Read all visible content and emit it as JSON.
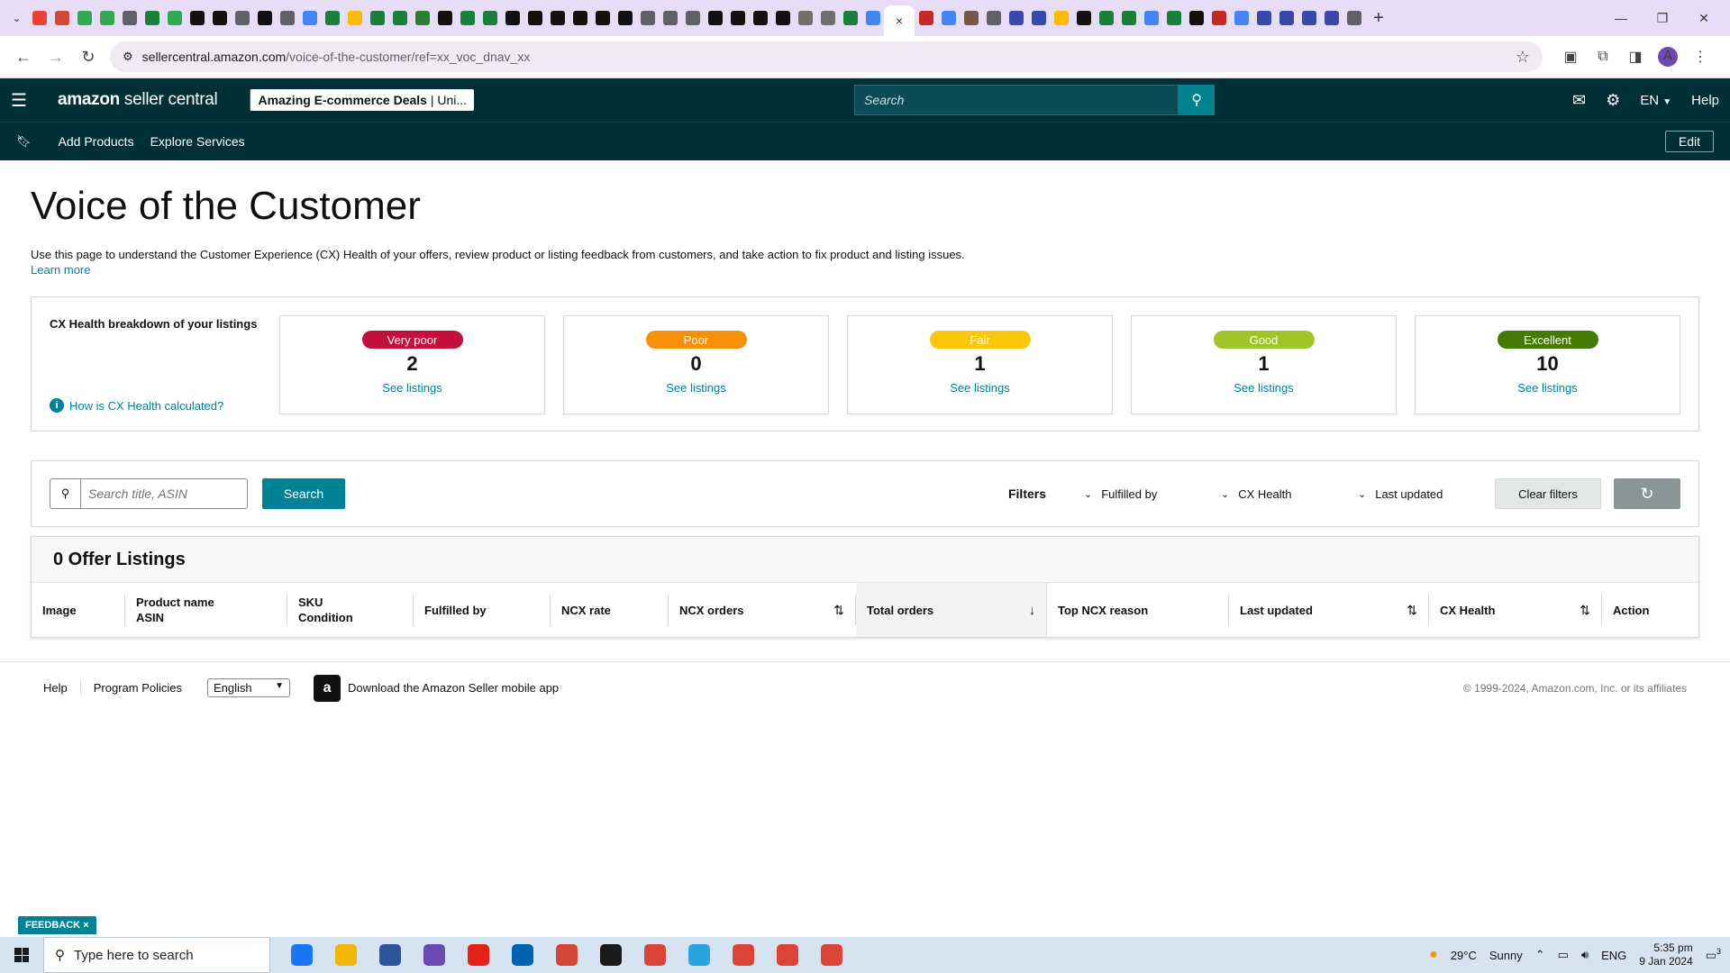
{
  "browser": {
    "tab_favicon_colors": [
      "#ea4335",
      "#d44638",
      "#34a853",
      "#34a853",
      "#5f6368",
      "#188038",
      "#34a853",
      "#111111",
      "#111111",
      "#5f6368",
      "#111111",
      "#5f6368",
      "#4285f4",
      "#188038",
      "#fbbc04",
      "#188038",
      "#188038",
      "#2e7d32",
      "#111111",
      "#188038",
      "#188038",
      "#111111",
      "#111111",
      "#111111",
      "#111111",
      "#111111",
      "#111111",
      "#5f6368",
      "#5f6368",
      "#5f6368",
      "#111111",
      "#111111",
      "#111111",
      "#111111",
      "#6f6f6f",
      "#6f6f6f",
      "#188038",
      "#4285f4"
    ],
    "tab_favicon_colors_right": [
      "#c62828",
      "#4285f4",
      "#795548",
      "#5f6368",
      "#3949ab",
      "#3949ab",
      "#fbbc04",
      "#111111",
      "#188038",
      "#188038",
      "#4285f4",
      "#188038",
      "#111111",
      "#c62828",
      "#4285f4",
      "#3949ab",
      "#3949ab",
      "#3949ab",
      "#3949ab",
      "#5f6368"
    ],
    "active_tab_close": "×",
    "new_tab": "+",
    "url_host": "sellercentral.amazon.com",
    "url_path": "/voice-of-the-customer/ref=xx_voc_dnav_xx",
    "avatar_letter": "A"
  },
  "header": {
    "logo_bold": "amazon",
    "logo_rest": " seller central",
    "store_name": "Amazing E-commerce Deals",
    "store_region": " | Uni...",
    "search_placeholder": "Search",
    "lang": "EN",
    "help": "Help"
  },
  "subnav": {
    "items": [
      "Add Products",
      "Explore Services"
    ],
    "edit": "Edit"
  },
  "page": {
    "title": "Voice of the Customer",
    "description": "Use this page to understand the Customer Experience (CX) Health of your offers, review product or listing feedback from customers, and take action to fix product and listing issues.",
    "learn_more": "Learn more"
  },
  "cx_health": {
    "title": "CX Health breakdown of your listings",
    "how_link": "How is CX Health calculated?",
    "cards": [
      {
        "label": "Very poor",
        "count": "2",
        "link": "See listings",
        "color": "#c40f3c"
      },
      {
        "label": "Poor",
        "count": "0",
        "link": "See listings",
        "color": "#f79009"
      },
      {
        "label": "Fair",
        "count": "1",
        "link": "See listings",
        "color": "#f9c80e"
      },
      {
        "label": "Good",
        "count": "1",
        "link": "See listings",
        "color": "#9fc628"
      },
      {
        "label": "Excellent",
        "count": "10",
        "link": "See listings",
        "color": "#447a03"
      }
    ]
  },
  "filters": {
    "search_placeholder": "Search title, ASIN",
    "search_button": "Search",
    "label": "Filters",
    "dropdowns": [
      "Fulfilled by",
      "CX Health",
      "Last updated"
    ],
    "clear": "Clear filters"
  },
  "listings": {
    "title": "0 Offer Listings",
    "columns": [
      {
        "line1": "Image",
        "line2": ""
      },
      {
        "line1": "Product name",
        "line2": "ASIN"
      },
      {
        "line1": "SKU",
        "line2": "Condition"
      },
      {
        "line1": "Fulfilled by",
        "line2": ""
      },
      {
        "line1": "NCX rate",
        "line2": ""
      },
      {
        "line1": "NCX orders",
        "line2": ""
      },
      {
        "line1": "Total orders",
        "line2": ""
      },
      {
        "line1": "Top NCX reason",
        "line2": ""
      },
      {
        "line1": "Last updated",
        "line2": ""
      },
      {
        "line1": "CX Health",
        "line2": ""
      },
      {
        "line1": "Action",
        "line2": ""
      }
    ]
  },
  "footer": {
    "help": "Help",
    "policies": "Program Policies",
    "language": "English",
    "app_download": "Download the Amazon Seller mobile app",
    "copyright": "© 1999-2024, Amazon.com, Inc. or its affiliates"
  },
  "feedback": "FEEDBACK",
  "taskbar": {
    "search_placeholder": "Type here to search",
    "app_colors": [
      "#1877f2",
      "#f2b705",
      "#2b579a",
      "#6b4bb1",
      "#e62117",
      "#0063b1",
      "#d44638",
      "#1a1a1a",
      "#db4437",
      "#2aa3e0",
      "#db4437",
      "#db4437",
      "#db4437"
    ],
    "temperature": "29°C",
    "weather": "Sunny",
    "lang": "ENG",
    "time": "5:35 pm",
    "date": "9 Jan 2024",
    "notifications": "3"
  }
}
